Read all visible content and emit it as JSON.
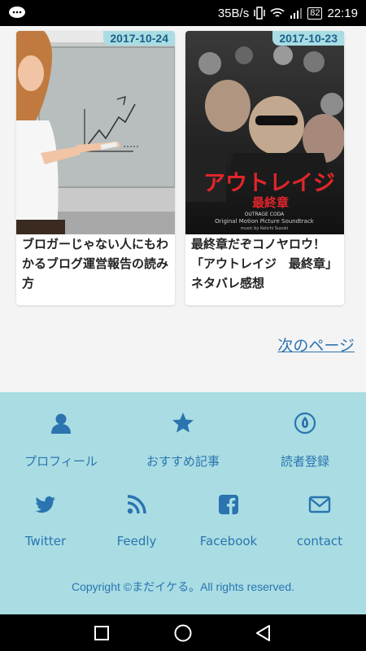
{
  "status": {
    "speed": "35B/s",
    "battery": "82",
    "time": "22:19"
  },
  "cards": [
    {
      "date": "2017-10-24",
      "title": "ブロガーじゃない人にもわかるブログ運営報告の読み方"
    },
    {
      "date": "2017-10-23",
      "title": "最終章だぞコノヤロウ！「アウトレイジ　最終章」ネタバレ感想",
      "poster_text": {
        "jp_title": "アウトレイジ",
        "subtitle": "最終章",
        "en": "OUTRAGE CODA",
        "soundtrack": "Original Motion Picture Soundtrack",
        "music": "music by Keiichi Suzuki"
      }
    }
  ],
  "next_page": "次のページ",
  "footer": {
    "items": [
      {
        "label": "プロフィール",
        "icon": "person-icon"
      },
      {
        "label": "おすすめ記事",
        "icon": "star-icon"
      },
      {
        "label": "読者登録",
        "icon": "subscribe-icon"
      },
      {
        "label": "Twitter",
        "icon": "twitter-icon"
      },
      {
        "label": "Feedly",
        "icon": "rss-icon"
      },
      {
        "label": "Facebook",
        "icon": "facebook-icon"
      },
      {
        "label": "contact",
        "icon": "mail-icon"
      }
    ],
    "copyright": "Copyright ©まだイケる。All rights reserved."
  },
  "colors": {
    "footer_bg": "#a9dde3",
    "link": "#2b74b0",
    "date_badge": "#a9dde3"
  }
}
